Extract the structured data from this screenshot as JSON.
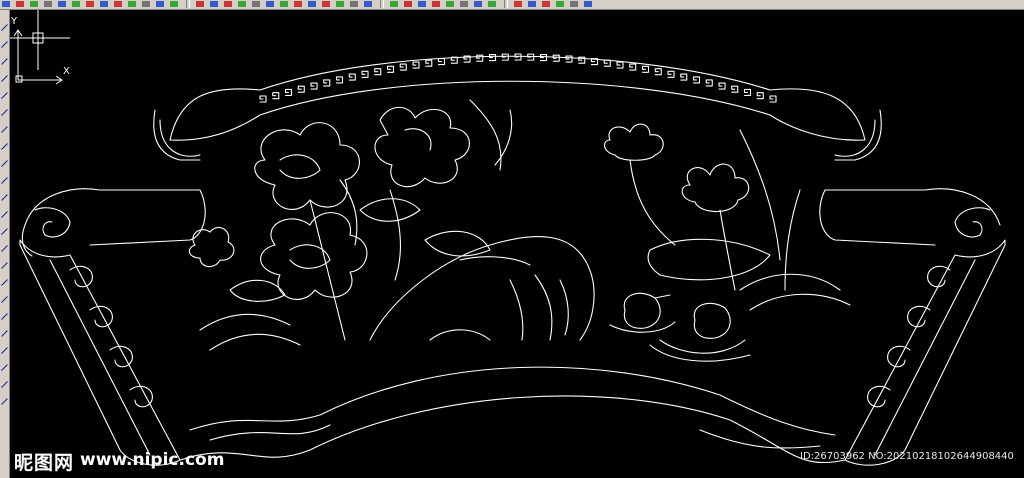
{
  "toolbar": {
    "top_buttons": [
      {
        "icon": "arrow-icon"
      },
      {
        "icon": "layer-icon"
      },
      {
        "icon": "red-x-icon"
      },
      {
        "icon": "copy-icon"
      },
      {
        "icon": "grid-icon"
      },
      {
        "icon": "green-block-icon"
      },
      {
        "icon": "blue-icon"
      },
      {
        "icon": "snap-icon"
      },
      {
        "icon": "ortho-icon"
      },
      {
        "icon": "polar-icon"
      },
      {
        "icon": "osnap-icon"
      },
      {
        "icon": "otrack-icon"
      },
      {
        "icon": "lwt-icon"
      },
      {
        "icon": "model-icon"
      },
      {
        "icon": "plot-icon"
      },
      {
        "icon": "preview-icon"
      },
      {
        "icon": "publish-icon"
      },
      {
        "icon": "match-icon"
      },
      {
        "icon": "table-icon"
      },
      {
        "icon": "calc-icon"
      },
      {
        "icon": "block-icon"
      },
      {
        "icon": "cut-icon"
      },
      {
        "icon": "paste-icon"
      },
      {
        "icon": "undo-icon"
      },
      {
        "icon": "redo-icon"
      },
      {
        "icon": "pan-icon"
      },
      {
        "icon": "zoom-icon"
      },
      {
        "icon": "properties-icon"
      },
      {
        "icon": "design-center-icon"
      },
      {
        "icon": "tool-palette-icon"
      },
      {
        "icon": "sheet-set-icon"
      },
      {
        "icon": "markup-icon"
      },
      {
        "icon": "quickcalc-icon"
      },
      {
        "icon": "help-icon"
      },
      {
        "icon": "text-icon"
      },
      {
        "icon": "dim-icon"
      },
      {
        "icon": "leader-icon"
      },
      {
        "icon": "hatch-icon"
      },
      {
        "icon": "region-icon"
      },
      {
        "icon": "lock-icon"
      }
    ],
    "colors": {
      "face": "#d4d0c8",
      "shadow": "#808080",
      "red": "#cc0000",
      "green": "#009900",
      "blue": "#0033cc"
    }
  },
  "left_toolbar": {
    "buttons": [
      {
        "icon": "line-icon"
      },
      {
        "icon": "construction-line-icon"
      },
      {
        "icon": "polyline-icon"
      },
      {
        "icon": "polygon-icon"
      },
      {
        "icon": "rectangle-icon"
      },
      {
        "icon": "arc-icon"
      },
      {
        "icon": "circle-icon"
      },
      {
        "icon": "revision-cloud-icon"
      },
      {
        "icon": "spline-icon"
      },
      {
        "icon": "ellipse-icon"
      },
      {
        "icon": "ellipse-arc-icon"
      },
      {
        "icon": "insert-block-icon"
      },
      {
        "icon": "make-block-icon"
      },
      {
        "icon": "point-icon"
      },
      {
        "icon": "hatch-icon"
      },
      {
        "icon": "gradient-icon"
      },
      {
        "icon": "region-icon"
      },
      {
        "icon": "table-icon"
      },
      {
        "icon": "mtext-icon"
      },
      {
        "icon": "erase-icon"
      },
      {
        "icon": "copy-icon"
      },
      {
        "icon": "mirror-icon"
      },
      {
        "icon": "offset-icon"
      }
    ]
  },
  "canvas": {
    "background": "#000000",
    "line_color": "#ffffff"
  },
  "ucs": {
    "y_label": "Y",
    "x_label": "X"
  },
  "watermark": {
    "logo": "昵图网",
    "url": "www.nipic.com",
    "id_text": "ID:26703962 NO:20210218102644908440"
  }
}
